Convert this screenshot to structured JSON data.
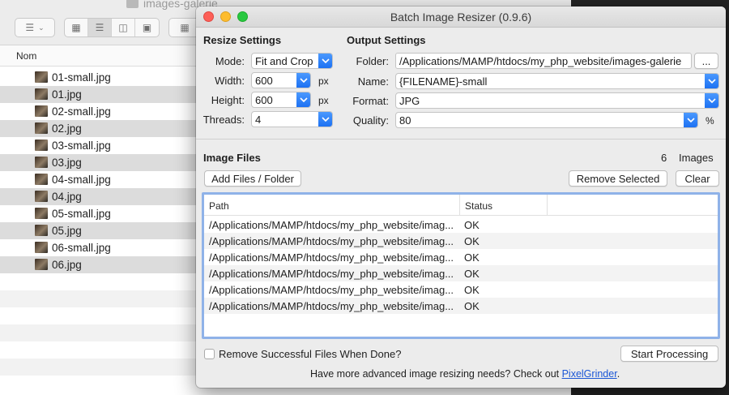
{
  "finder": {
    "folder_title": "images-galerie",
    "column_header": "Nom",
    "files": [
      "01-small.jpg",
      "01.jpg",
      "02-small.jpg",
      "02.jpg",
      "03-small.jpg",
      "03.jpg",
      "04-small.jpg",
      "04.jpg",
      "05-small.jpg",
      "05.jpg",
      "06-small.jpg",
      "06.jpg"
    ]
  },
  "dialog": {
    "title": "Batch Image Resizer (0.9.6)",
    "resize_settings": {
      "heading": "Resize Settings",
      "mode_label": "Mode:",
      "mode_value": "Fit and Crop",
      "width_label": "Width:",
      "width_value": "600",
      "width_unit": "px",
      "height_label": "Height:",
      "height_value": "600",
      "height_unit": "px",
      "threads_label": "Threads:",
      "threads_value": "4"
    },
    "output_settings": {
      "heading": "Output Settings",
      "folder_label": "Folder:",
      "folder_value": "/Applications/MAMP/htdocs/my_php_website/images-galerie",
      "browse_label": "...",
      "name_label": "Name:",
      "name_value": "{FILENAME}-small",
      "format_label": "Format:",
      "format_value": "JPG",
      "quality_label": "Quality:",
      "quality_value": "80",
      "quality_unit": "%"
    },
    "image_files": {
      "heading": "Image Files",
      "count": "6",
      "count_label": "Images",
      "add_button": "Add Files / Folder",
      "remove_button": "Remove Selected",
      "clear_button": "Clear",
      "columns": {
        "path": "Path",
        "status": "Status"
      },
      "rows": [
        {
          "path": "/Applications/MAMP/htdocs/my_php_website/imag...",
          "status": "OK"
        },
        {
          "path": "/Applications/MAMP/htdocs/my_php_website/imag...",
          "status": "OK"
        },
        {
          "path": "/Applications/MAMP/htdocs/my_php_website/imag...",
          "status": "OK"
        },
        {
          "path": "/Applications/MAMP/htdocs/my_php_website/imag...",
          "status": "OK"
        },
        {
          "path": "/Applications/MAMP/htdocs/my_php_website/imag...",
          "status": "OK"
        },
        {
          "path": "/Applications/MAMP/htdocs/my_php_website/imag...",
          "status": "OK"
        }
      ]
    },
    "remove_successful_label": "Remove Successful Files When Done?",
    "start_button": "Start Processing",
    "footer_text": "Have more advanced image resizing needs? Check out ",
    "footer_link": "PixelGrinder",
    "footer_end": "."
  },
  "colors": {
    "accent": "#1a6ff2",
    "link": "#1a56d6",
    "table_focus": "#8fb2e8"
  },
  "icons": [
    "folder-icon",
    "list-view-icon",
    "icon-view-icon",
    "column-view-icon",
    "gallery-view-icon",
    "chevron-down-icon",
    "image-thumbnail-icon"
  ]
}
